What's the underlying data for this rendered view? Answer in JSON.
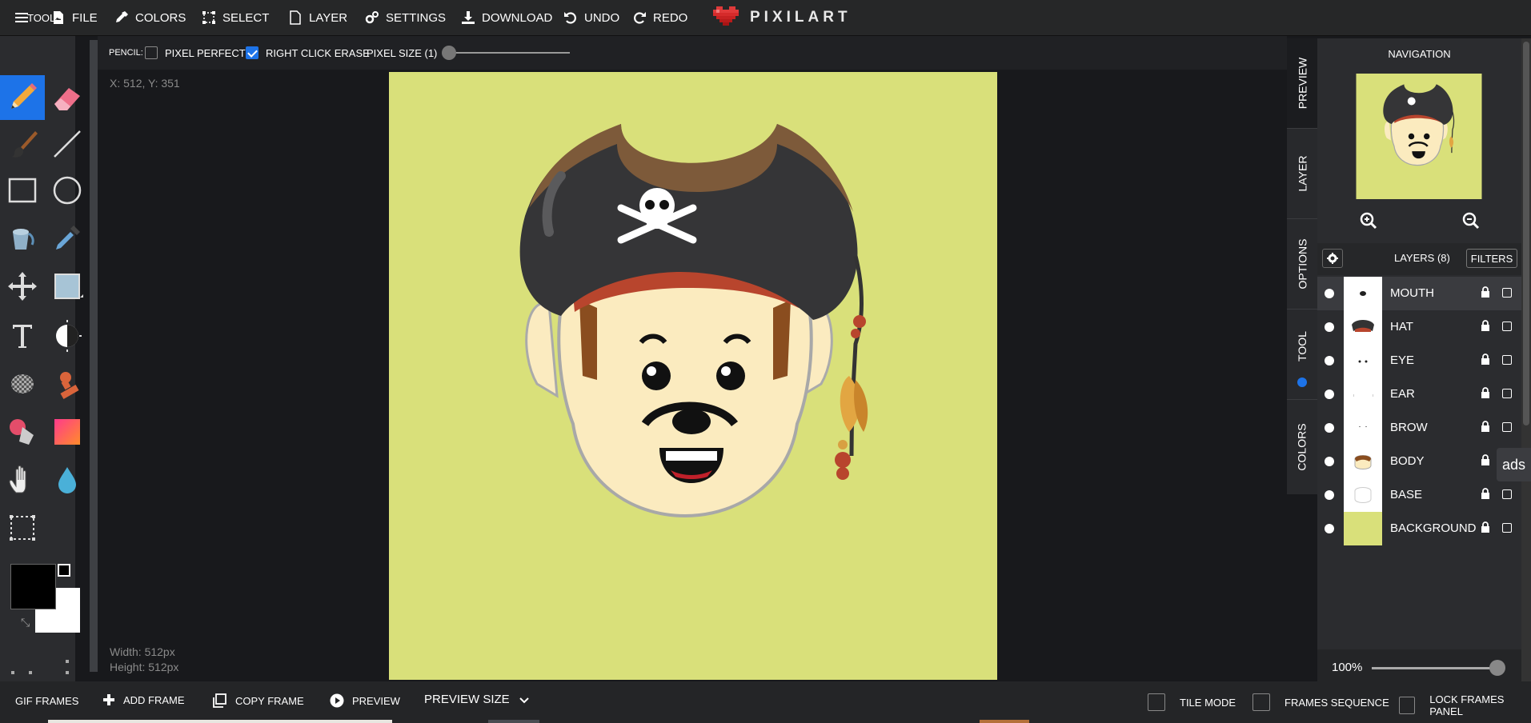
{
  "topbar": {
    "file": "FILE",
    "colors": "COLORS",
    "select": "SELECT",
    "layer": "LAYER",
    "settings": "SETTINGS",
    "download": "DOWNLOAD",
    "undo": "UNDO",
    "redo": "REDO",
    "logo": "PIXILART"
  },
  "tools": {
    "title": "TOOLS",
    "items": [
      "pencil-icon",
      "eraser-icon",
      "brush-icon",
      "line-icon",
      "rectangle-icon",
      "circle-icon",
      "bucket-icon",
      "eyedropper-icon",
      "move-icon",
      "shape-fill-icon",
      "text-icon",
      "lighten-icon",
      "dither-icon",
      "stamp-icon",
      "color-replace-icon",
      "gradient-icon",
      "hand-icon",
      "blur-icon",
      "select-icon"
    ],
    "primary_color": "#000000",
    "secondary_color": "#ffffff"
  },
  "options": {
    "tool_label": "PENCIL:",
    "pixel_perfect": "PIXEL PERFECT",
    "pixel_perfect_checked": false,
    "right_click_erase": "RIGHT CLICK ERASE",
    "right_click_erase_checked": true,
    "pixel_size": "PIXEL SIZE (1)"
  },
  "canvas": {
    "coords": "X: 512, Y: 351",
    "width_label": "Width: 512px",
    "height_label": "Height: 512px",
    "background_color": "#d9e07a"
  },
  "side_tabs": [
    "PREVIEW",
    "LAYER",
    "OPTIONS",
    "TOOL",
    "COLORS"
  ],
  "navigation": {
    "title": "NAVIGATION",
    "zoom_in": "zoom-in-icon",
    "zoom_out": "zoom-out-icon"
  },
  "layers": {
    "title": "LAYERS (8)",
    "filters": "FILTERS",
    "items": [
      {
        "name": "MOUTH"
      },
      {
        "name": "HAT"
      },
      {
        "name": "EYE"
      },
      {
        "name": "EAR"
      },
      {
        "name": "BROW"
      },
      {
        "name": "BODY"
      },
      {
        "name": "BASE"
      },
      {
        "name": "BACKGROUND"
      }
    ]
  },
  "ads": "ads",
  "zoom": {
    "percent": "100%"
  },
  "bottombar": {
    "gif_frames": "GIF FRAMES",
    "add_frame": "ADD FRAME",
    "copy_frame": "COPY FRAME",
    "preview": "PREVIEW",
    "preview_size": "PREVIEW SIZE",
    "tile_mode": "TILE MODE",
    "frames_sequence": "FRAMES SEQUENCE",
    "lock_frames_panel": "LOCK FRAMES PANEL"
  }
}
